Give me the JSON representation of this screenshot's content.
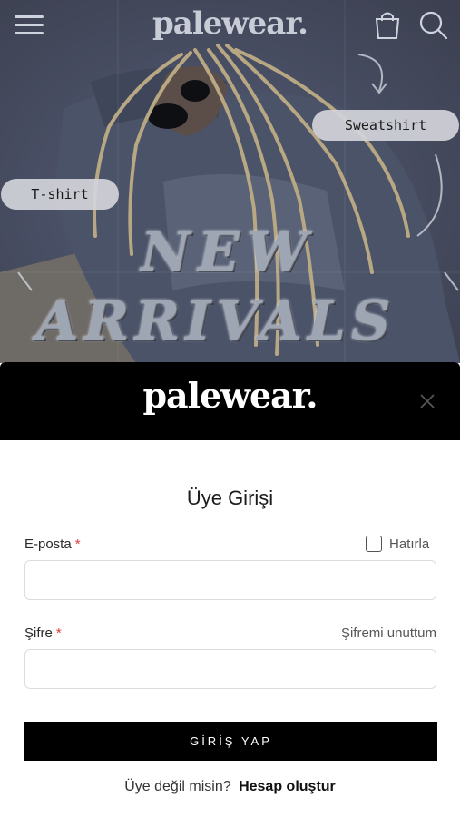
{
  "brand": {
    "logo_text": "palewear."
  },
  "header": {
    "menu_icon": "hamburger-menu-icon",
    "bag_icon": "shopping-bag-icon",
    "search_icon": "search-icon"
  },
  "hero": {
    "tags": {
      "sweatshirt": "Sweatshirt",
      "tshirt": "T-shirt"
    },
    "headline_line1": "NEW",
    "headline_line2": "ARRIVALS"
  },
  "modal": {
    "logo_text": "palewear.",
    "close_icon": "close-icon",
    "title": "Üye Girişi",
    "email_label": "E-posta",
    "password_label": "Şifre",
    "required_mark": "*",
    "remember_label": "Hatırla",
    "forgot_label": "Şifremi unuttum",
    "email_value": "",
    "password_value": "",
    "submit_label": "GİRİŞ YAP",
    "signup_prompt": "Üye değil misin?",
    "signup_link": "Hesap oluştur"
  },
  "colors": {
    "overlay": "#3b3f4f",
    "modal_header": "#000000",
    "button_bg": "#000000",
    "required": "#e03b3b"
  }
}
